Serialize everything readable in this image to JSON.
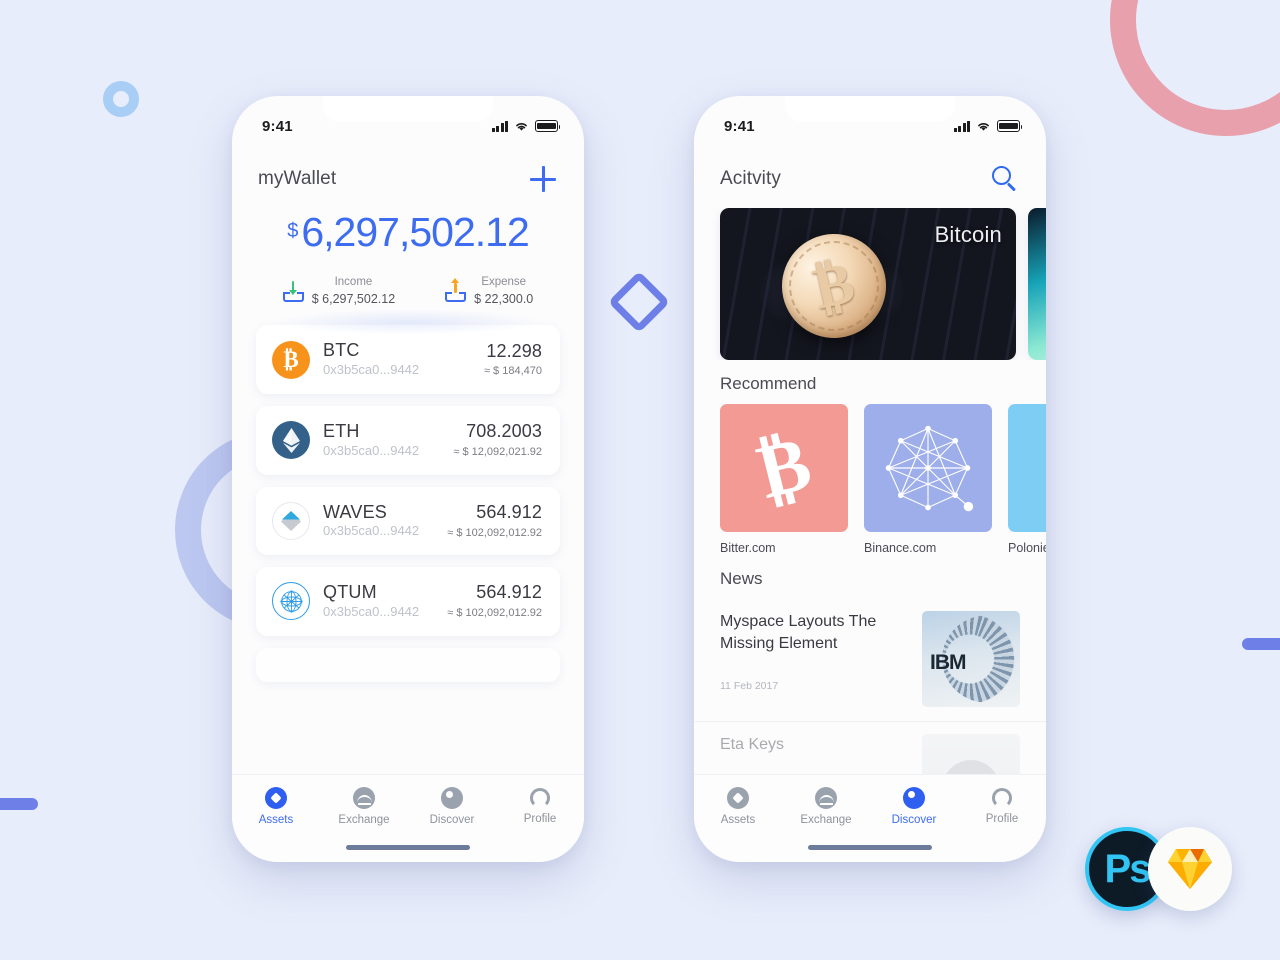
{
  "background": {
    "color": "#E8EDFB",
    "shapes": [
      {
        "name": "ring-blue-small",
        "color": "#A8CEF5"
      },
      {
        "name": "ring-periwinkle-large",
        "color": "#B9C6EF"
      },
      {
        "name": "arc-pink",
        "color": "#E8A0AC"
      },
      {
        "name": "bar-left",
        "color": "#6E80E8"
      },
      {
        "name": "bar-right",
        "color": "#6E80E8"
      },
      {
        "name": "diamond-deco",
        "color": "#6E80E8"
      }
    ]
  },
  "accent": "#3D6CF0",
  "phone_left": {
    "statusbar": {
      "time": "9:41"
    },
    "header": {
      "title": "myWallet",
      "add_icon": "plus-icon"
    },
    "balance": {
      "currency_symbol": "$",
      "amount": "6,297,502.12",
      "income": {
        "label": "Income",
        "value": "$ 6,297,502.12",
        "icon": "tray-download-icon"
      },
      "expense": {
        "label": "Expense",
        "value": "$ 22,300.0",
        "icon": "tray-upload-icon"
      }
    },
    "assets": [
      {
        "symbol": "BTC",
        "address": "0x3b5ca0...9442",
        "amount": "12.298",
        "fiat": "≈ $ 184,470",
        "icon": "btc-coin-icon"
      },
      {
        "symbol": "ETH",
        "address": "0x3b5ca0...9442",
        "amount": "708.2003",
        "fiat": "≈ $ 12,092,021.92",
        "icon": "eth-coin-icon"
      },
      {
        "symbol": "WAVES",
        "address": "0x3b5ca0...9442",
        "amount": "564.912",
        "fiat": "≈ $ 102,092,012.92",
        "icon": "waves-coin-icon"
      },
      {
        "symbol": "QTUM",
        "address": "0x3b5ca0...9442",
        "amount": "564.912",
        "fiat": "≈ $ 102,092,012.92",
        "icon": "qtum-coin-icon"
      }
    ],
    "tabs": [
      {
        "label": "Assets",
        "icon": "assets-icon",
        "active": true
      },
      {
        "label": "Exchange",
        "icon": "exchange-icon",
        "active": false
      },
      {
        "label": "Discover",
        "icon": "discover-icon",
        "active": false
      },
      {
        "label": "Profile",
        "icon": "profile-icon",
        "active": false
      }
    ]
  },
  "phone_right": {
    "statusbar": {
      "time": "9:41"
    },
    "header": {
      "title": "Acitvity",
      "search_icon": "search-icon"
    },
    "activity_cards": [
      {
        "label": "Bitcoin",
        "image": "bitcoin-coin-on-keyboard"
      },
      {
        "label": "",
        "image": "aurora-teal"
      }
    ],
    "recommend": {
      "title": "Recommend",
      "items": [
        {
          "name": "Bitter.com",
          "color": "#F49A94",
          "icon": "bitcoin-glyph-icon"
        },
        {
          "name": "Binance.com",
          "color": "#9DAEEA",
          "icon": "network-mesh-icon"
        },
        {
          "name": "Polonie",
          "color": "#7ECDF5",
          "icon": "star-icon"
        }
      ]
    },
    "news": {
      "title": "News",
      "items": [
        {
          "title": "Myspace Layouts The Missing Element",
          "date": "11 Feb 2017",
          "thumb": "ibm-server-photo"
        },
        {
          "title": "Eta Keys",
          "date": "",
          "thumb": "avatar-photo"
        }
      ]
    },
    "tabs": [
      {
        "label": "Assets",
        "icon": "assets-icon",
        "active": false
      },
      {
        "label": "Exchange",
        "icon": "exchange-icon",
        "active": false
      },
      {
        "label": "Discover",
        "icon": "discover-icon",
        "active": true
      },
      {
        "label": "Profile",
        "icon": "profile-icon",
        "active": false
      }
    ]
  },
  "badges": [
    {
      "name": "photoshop-badge",
      "label": "Ps",
      "color": "#31C5F4"
    },
    {
      "name": "sketch-badge",
      "label": "",
      "color": "#F7B500"
    }
  ]
}
